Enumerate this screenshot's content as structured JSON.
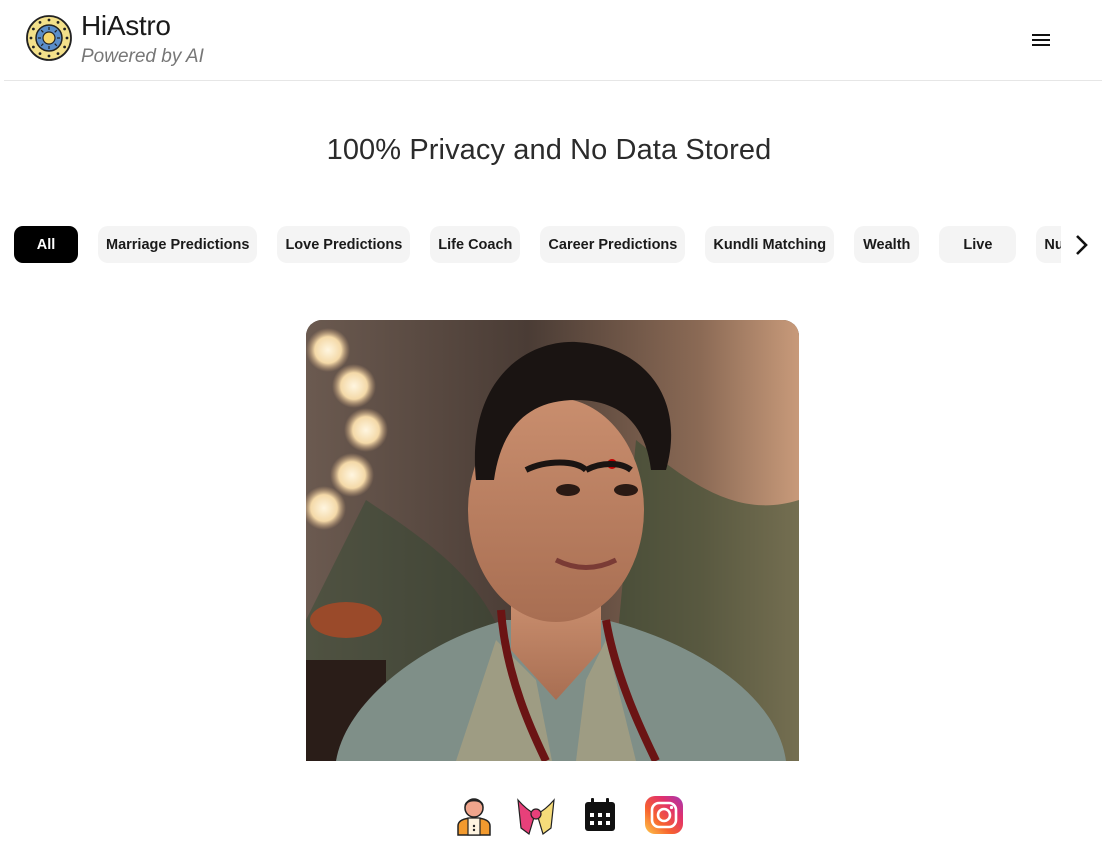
{
  "header": {
    "brand_title": "HiAstro",
    "brand_subtitle": "Powered by AI",
    "logo_icon": "zodiac-wheel-icon",
    "menu_icon": "hamburger-menu-icon"
  },
  "main": {
    "headline": "100% Privacy and No Data Stored",
    "categories": [
      {
        "label": "All",
        "active": true
      },
      {
        "label": "Marriage Predictions",
        "active": false
      },
      {
        "label": "Love Predictions",
        "active": false
      },
      {
        "label": "Life Coach",
        "active": false
      },
      {
        "label": "Career Predictions",
        "active": false
      },
      {
        "label": "Kundli Matching",
        "active": false
      },
      {
        "label": "Wealth",
        "active": false
      },
      {
        "label": "Live",
        "active": false
      },
      {
        "label": "Numerology",
        "active": false
      }
    ],
    "next_icon": "chevron-right-icon",
    "hero_image": "astrologer-portrait-image"
  },
  "bottom_icons": [
    {
      "name": "astrologer-icon"
    },
    {
      "name": "wedding-garland-icon"
    },
    {
      "name": "calendar-icon"
    },
    {
      "name": "instagram-icon"
    }
  ],
  "colors": {
    "active_chip_bg": "#000000",
    "chip_bg": "#f4f4f4",
    "logo_ring": "#f3e08a",
    "logo_center": "#5b8ec9"
  }
}
